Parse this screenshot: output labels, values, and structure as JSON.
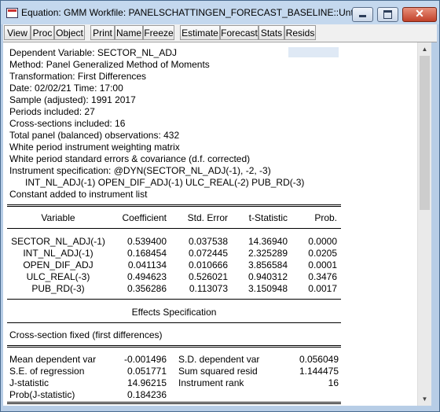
{
  "window": {
    "title": "Equation: GMM   Workfile: PANELSCHATTINGEN_FORECAST_BASELINE::Untitl...",
    "close_glyph": "✕"
  },
  "toolbar": {
    "buttons": [
      "View",
      "Proc",
      "Object",
      "Print",
      "Name",
      "Freeze",
      "Estimate",
      "Forecast",
      "Stats",
      "Resids"
    ]
  },
  "header_lines": [
    "Dependent Variable: SECTOR_NL_ADJ",
    "Method: Panel Generalized Method of Moments",
    "Transformation: First Differences",
    "Date: 02/02/21   Time: 17:00",
    "Sample (adjusted): 1991 2017",
    "Periods included: 27",
    "Cross-sections included: 16",
    "Total panel (balanced) observations: 432",
    "White period instrument weighting matrix",
    "White period standard errors & covariance (d.f. corrected)",
    "Instrument specification: @DYN(SECTOR_NL_ADJ(-1), -2, -3)",
    "      INT_NL_ADJ(-1) OPEN_DIF_ADJ(-1) ULC_REAL(-2) PUB_RD(-3)",
    "Constant added to instrument list"
  ],
  "coef_table": {
    "headers": [
      "Variable",
      "Coefficient",
      "Std. Error",
      "t-Statistic",
      "Prob."
    ],
    "rows": [
      [
        "SECTOR_NL_ADJ(-1)",
        "0.539400",
        "0.037538",
        "14.36940",
        "0.0000"
      ],
      [
        "INT_NL_ADJ(-1)",
        "0.168454",
        "0.072445",
        "2.325289",
        "0.0205"
      ],
      [
        "OPEN_DIF_ADJ",
        "0.041134",
        "0.010666",
        "3.856584",
        "0.0001"
      ],
      [
        "ULC_REAL(-3)",
        "0.494623",
        "0.526021",
        "0.940312",
        "0.3476"
      ],
      [
        "PUB_RD(-3)",
        "0.356286",
        "0.113073",
        "3.150948",
        "0.0017"
      ]
    ]
  },
  "effects": {
    "title": "Effects Specification",
    "line": "Cross-section fixed (first differences)"
  },
  "stats": {
    "rows": [
      [
        "Mean dependent var",
        "-0.001496",
        "S.D. dependent var",
        "0.056049"
      ],
      [
        "S.E. of regression",
        "0.051771",
        "Sum squared resid",
        "1.144475"
      ],
      [
        "J-statistic",
        "14.96215",
        "Instrument rank",
        "16"
      ],
      [
        "Prob(J-statistic)",
        "0.184236",
        "",
        ""
      ]
    ]
  },
  "scrollbar": {
    "up": "▲",
    "down": "▼"
  }
}
